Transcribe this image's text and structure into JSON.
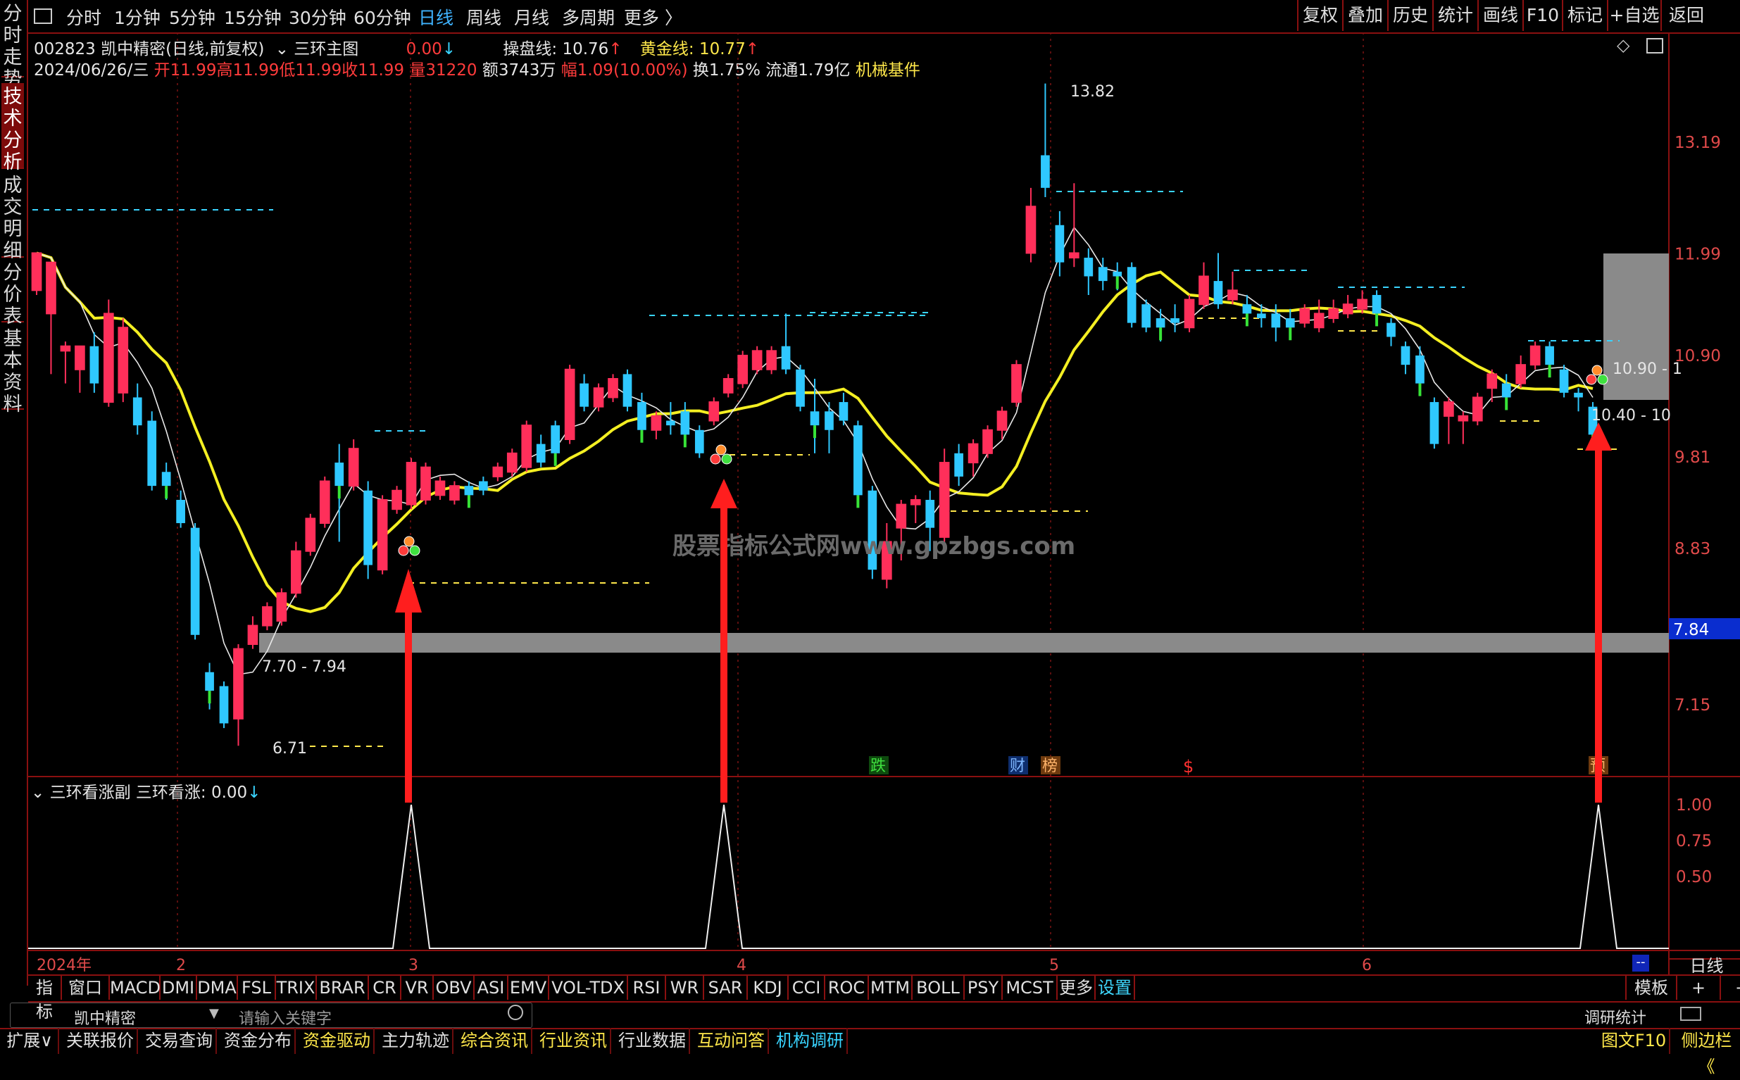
{
  "colors": {
    "up": "#ff2f5a",
    "down": "#2fc8ff",
    "bull_green": "#37e337",
    "ma_yellow": "#f4ef22",
    "ma_white": "#e8e8e8",
    "frame": "#8a1010",
    "dash_cyan": "#39d4ff",
    "dash_yellow": "#ffe84a",
    "band": "#8a8a8a"
  },
  "left_tabs": [
    "分时走势",
    "技术分析",
    "成交明细",
    "分价表",
    "基本资料"
  ],
  "top_menu": [
    "分时",
    "1分钟",
    "5分钟",
    "15分钟",
    "30分钟",
    "60分钟",
    "日线",
    "周线",
    "月线",
    "多周期",
    "更多"
  ],
  "top_menu_selected": "日线",
  "top_right": [
    "复权",
    "叠加",
    "历史",
    "统计",
    "画线",
    "F10",
    "标记",
    "+自选",
    "返回"
  ],
  "info": {
    "code_name": "002823 凯中精密(日线,前复权)",
    "indicator": "三环主图",
    "ind_value": "0.00",
    "caopan_label": "操盘线:",
    "caopan_value": "10.76",
    "gold_label": "黄金线:",
    "gold_value": "10.77",
    "date": "2024/06/26/三",
    "open": "开11.99",
    "high": "高11.99",
    "low": "低11.99",
    "close": "收11.99",
    "vol": "量31220",
    "amount": "额3743万",
    "change": "幅1.09(10.00%)",
    "turnover": "换1.75%",
    "float": "流通1.79亿",
    "sector": "机械基件"
  },
  "sub_info": {
    "name": "三环看涨副",
    "label": "三环看涨:",
    "value": "0.00"
  },
  "chart_data": {
    "type": "candlestick",
    "y_ticks": [
      "13.19",
      "11.99",
      "10.90",
      "9.81",
      "8.83",
      "7.15"
    ],
    "current_price_tag": "7.84",
    "annotations": {
      "high": "13.82",
      "low": "6.71",
      "range_low": "7.70 - 7.94",
      "range_a": "10.90 - 1",
      "range_b": "10.40 - 10"
    },
    "x_labels": [
      "2024年",
      "2",
      "3",
      "4",
      "5",
      "6"
    ],
    "event_markers": [
      "跌",
      "财",
      "榜",
      "$",
      "预"
    ],
    "watermark": "股票指标公式网www.gpzbgs.com",
    "sub_ticks": [
      "1.00",
      "0.75",
      "0.50"
    ],
    "signal_spikes": 3,
    "candles": [
      [
        11.6,
        12.0,
        11.95,
        11.55
      ],
      [
        11.35,
        11.9,
        11.7,
        10.7
      ],
      [
        10.95,
        11.0,
        11.05,
        10.6
      ],
      [
        10.75,
        11.0,
        10.85,
        10.5
      ],
      [
        11.0,
        10.6,
        11.15,
        10.5
      ],
      [
        10.4,
        11.35,
        11.5,
        10.35
      ],
      [
        10.5,
        11.2,
        11.3,
        10.4
      ],
      [
        10.45,
        10.15,
        10.6,
        10.05
      ],
      [
        10.2,
        9.5,
        10.3,
        9.45
      ],
      [
        9.65,
        9.5,
        9.75,
        9.35
      ],
      [
        9.35,
        9.1,
        9.45,
        9.05
      ],
      [
        9.05,
        7.9,
        9.1,
        7.85
      ],
      [
        7.5,
        7.3,
        7.6,
        7.1
      ],
      [
        7.35,
        6.95,
        7.4,
        6.9
      ],
      [
        7.0,
        7.75,
        7.8,
        6.71
      ],
      [
        7.8,
        8.0,
        8.1,
        7.75
      ],
      [
        8.0,
        8.2,
        8.25,
        7.95
      ],
      [
        8.05,
        8.35,
        8.4,
        8.0
      ],
      [
        8.35,
        8.8,
        8.9,
        8.3
      ],
      [
        8.8,
        9.15,
        9.2,
        8.75
      ],
      [
        9.1,
        9.55,
        9.6,
        9.05
      ],
      [
        9.75,
        9.5,
        9.95,
        8.9
      ],
      [
        9.5,
        9.9,
        10.0,
        9.45
      ],
      [
        9.45,
        8.65,
        9.55,
        8.5
      ],
      [
        8.6,
        9.35,
        9.4,
        8.55
      ],
      [
        9.25,
        9.45,
        9.5,
        9.2
      ],
      [
        9.3,
        9.75,
        9.8,
        9.25
      ],
      [
        9.35,
        9.7,
        9.75,
        9.3
      ],
      [
        9.4,
        9.55,
        9.6,
        9.35
      ],
      [
        9.35,
        9.5,
        9.55,
        9.3
      ],
      [
        9.5,
        9.4,
        9.55,
        9.3
      ],
      [
        9.55,
        9.45,
        9.6,
        9.4
      ],
      [
        9.6,
        9.7,
        9.75,
        9.55
      ],
      [
        9.65,
        9.85,
        9.9,
        9.6
      ],
      [
        9.7,
        10.15,
        10.2,
        9.65
      ],
      [
        9.95,
        9.75,
        10.05,
        9.7
      ],
      [
        10.15,
        9.85,
        10.2,
        9.8
      ],
      [
        10.0,
        10.75,
        10.8,
        9.95
      ],
      [
        10.6,
        10.35,
        10.7,
        10.3
      ],
      [
        10.35,
        10.55,
        10.6,
        10.3
      ],
      [
        10.45,
        10.65,
        10.7,
        10.4
      ],
      [
        10.7,
        10.35,
        10.75,
        10.3
      ],
      [
        10.4,
        10.1,
        10.5,
        10.05
      ],
      [
        10.1,
        10.25,
        10.3,
        10.0
      ],
      [
        10.2,
        10.15,
        10.4,
        10.05
      ],
      [
        10.3,
        10.05,
        10.4,
        10.0
      ],
      [
        10.1,
        9.85,
        10.15,
        9.8
      ],
      [
        10.2,
        10.4,
        10.45,
        10.15
      ],
      [
        10.5,
        10.65,
        10.7,
        10.45
      ],
      [
        10.6,
        10.9,
        10.95,
        10.55
      ],
      [
        10.75,
        10.95,
        11.0,
        10.7
      ],
      [
        10.75,
        10.95,
        11.0,
        10.7
      ],
      [
        11.0,
        10.75,
        11.35,
        10.7
      ],
      [
        10.75,
        10.35,
        10.8,
        10.3
      ],
      [
        10.3,
        10.15,
        10.65,
        9.85
      ],
      [
        10.3,
        10.1,
        10.4,
        9.85
      ],
      [
        10.4,
        10.2,
        10.5,
        10.15
      ],
      [
        10.15,
        9.4,
        10.2,
        9.35
      ],
      [
        9.45,
        8.6,
        9.5,
        8.5
      ],
      [
        8.5,
        8.9,
        9.1,
        8.4
      ],
      [
        9.05,
        9.3,
        9.35,
        8.7
      ],
      [
        9.3,
        9.35,
        9.4,
        9.1
      ],
      [
        9.35,
        9.05,
        9.45,
        8.8
      ],
      [
        8.95,
        9.75,
        9.9,
        8.9
      ],
      [
        9.85,
        9.6,
        9.95,
        9.5
      ],
      [
        9.75,
        9.95,
        10.0,
        9.6
      ],
      [
        9.85,
        10.1,
        10.15,
        9.8
      ],
      [
        10.1,
        10.3,
        10.35,
        10.0
      ],
      [
        10.4,
        10.8,
        10.85,
        10.35
      ],
      [
        12.0,
        12.5,
        12.7,
        11.9
      ],
      [
        13.05,
        12.7,
        13.82,
        12.6
      ],
      [
        12.3,
        11.9,
        12.45,
        11.75
      ],
      [
        11.95,
        12.0,
        12.75,
        11.85
      ],
      [
        11.95,
        11.75,
        12.05,
        11.55
      ],
      [
        11.85,
        11.7,
        11.95,
        11.6
      ],
      [
        11.8,
        11.75,
        11.9,
        11.6
      ],
      [
        11.85,
        11.25,
        11.9,
        11.2
      ],
      [
        11.45,
        11.2,
        11.5,
        11.15
      ],
      [
        11.3,
        11.2,
        11.4,
        11.05
      ],
      [
        11.3,
        11.25,
        11.45,
        11.15
      ],
      [
        11.2,
        11.5,
        11.55,
        11.15
      ],
      [
        11.45,
        11.75,
        11.9,
        11.4
      ],
      [
        11.7,
        11.45,
        12.0,
        11.4
      ],
      [
        11.5,
        11.6,
        11.8,
        11.45
      ],
      [
        11.45,
        11.35,
        11.55,
        11.3
      ],
      [
        11.35,
        11.3,
        11.45,
        11.2
      ],
      [
        11.35,
        11.2,
        11.45,
        11.05
      ],
      [
        11.3,
        11.2,
        11.4,
        11.1
      ],
      [
        11.25,
        11.4,
        11.45,
        11.2
      ],
      [
        11.2,
        11.35,
        11.5,
        11.15
      ],
      [
        11.3,
        11.4,
        11.5,
        11.25
      ],
      [
        11.35,
        11.45,
        11.55,
        11.3
      ],
      [
        11.4,
        11.5,
        11.6,
        11.35
      ],
      [
        11.55,
        11.35,
        11.6,
        11.3
      ],
      [
        11.25,
        11.1,
        11.3,
        11.0
      ],
      [
        11.0,
        10.8,
        11.05,
        10.7
      ],
      [
        10.9,
        10.6,
        11.0,
        10.55
      ],
      [
        10.4,
        9.95,
        10.45,
        9.9
      ],
      [
        10.25,
        10.4,
        10.45,
        9.95
      ],
      [
        10.2,
        10.25,
        10.3,
        9.95
      ],
      [
        10.2,
        10.45,
        10.5,
        10.15
      ],
      [
        10.55,
        10.7,
        10.75,
        10.4
      ],
      [
        10.6,
        10.45,
        10.7,
        10.4
      ],
      [
        10.6,
        10.8,
        10.9,
        10.55
      ],
      [
        10.8,
        11.0,
        11.05,
        10.75
      ],
      [
        11.0,
        10.8,
        11.05,
        10.75
      ],
      [
        10.75,
        10.5,
        10.8,
        10.45
      ],
      [
        10.5,
        10.45,
        10.55,
        10.3
      ],
      [
        10.35,
        10.05,
        10.4,
        10.0
      ]
    ]
  },
  "indicator_tabs": [
    "指标",
    "窗口",
    "MACD",
    "DMI",
    "DMA",
    "FSL",
    "TRIX",
    "BRAR",
    "CR",
    "VR",
    "OBV",
    "ASI",
    "EMV",
    "VOL-TDX",
    "RSI",
    "WR",
    "SAR",
    "KDJ",
    "CCI",
    "ROC",
    "MTM",
    "BOLL",
    "PSY",
    "MCST",
    "更多",
    "设置"
  ],
  "indicator_right": [
    "模板",
    "+",
    "−"
  ],
  "bottom_right": {
    "period": "日线",
    "minus": "--"
  },
  "search": {
    "stock_name": "凯中精密",
    "placeholder": "请输入关键字",
    "right_label": "调研统计"
  },
  "footer_tabs": [
    "扩展∨",
    "关联报价",
    "交易查询",
    "资金分布",
    "资金驱动",
    "主力轨迹",
    "综合资讯",
    "行业资讯",
    "行业数据",
    "互动问答",
    "机构调研"
  ],
  "footer_right": [
    "图文F10",
    "侧边栏《"
  ]
}
